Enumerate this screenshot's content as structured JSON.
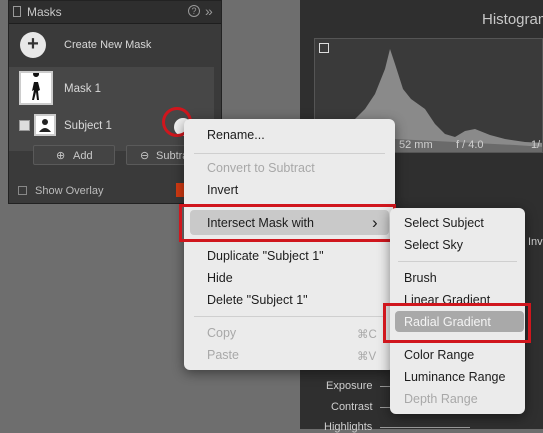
{
  "masks_panel": {
    "title": "Masks",
    "help_icon": "?",
    "collapse_icon": "»",
    "create_label": "Create New Mask",
    "create_icon": "+",
    "mask1_label": "Mask 1",
    "subject_label": "Subject 1",
    "add_label": "Add",
    "subtract_label": "Subtra",
    "show_overlay_label": "Show Overlay"
  },
  "right_panel": {
    "histogram_title": "Histogram",
    "focal_length": "52 mm",
    "aperture": "f / 4.0",
    "shutter_fragment": "1/",
    "inv_fragment": "Inv",
    "sliders": [
      "Exposure",
      "Contrast",
      "Highlights"
    ]
  },
  "context_menu": {
    "items": [
      {
        "label": "Rename...",
        "enabled": true
      },
      {
        "label": "Convert to Subtract",
        "enabled": false
      },
      {
        "label": "Invert",
        "enabled": true
      },
      {
        "label": "Intersect Mask with",
        "enabled": true,
        "submenu": true,
        "arrow": "›"
      },
      {
        "label": "Duplicate \"Subject 1\"",
        "enabled": true
      },
      {
        "label": "Hide",
        "enabled": true
      },
      {
        "label": "Delete \"Subject 1\"",
        "enabled": true
      },
      {
        "label": "Copy",
        "enabled": false,
        "shortcut": "⌘C"
      },
      {
        "label": "Paste",
        "enabled": false,
        "shortcut": "⌘V"
      }
    ]
  },
  "submenu": {
    "items": [
      {
        "label": "Select Subject",
        "enabled": true
      },
      {
        "label": "Select Sky",
        "enabled": true
      },
      {
        "label": "Brush",
        "enabled": true
      },
      {
        "label": "Linear Gradient",
        "enabled": true
      },
      {
        "label": "Radial Gradient",
        "enabled": true,
        "highlighted": true
      },
      {
        "label": "Color Range",
        "enabled": true
      },
      {
        "label": "Luminance Range",
        "enabled": true
      },
      {
        "label": "Depth Range",
        "enabled": false
      }
    ]
  },
  "colors": {
    "highlight_red": "#d0161d",
    "menu_bg": "#ebebeb",
    "selected_row": "#c9c9c9",
    "radial_highlight": "#a9a9a9"
  }
}
